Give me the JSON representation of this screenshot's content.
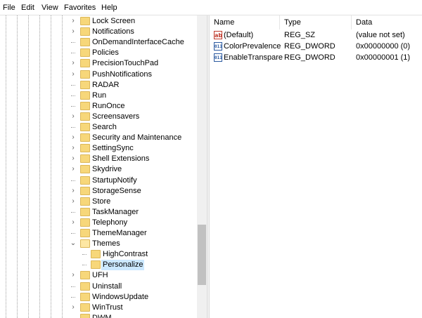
{
  "menu": [
    {
      "label": "File"
    },
    {
      "label": "Edit"
    },
    {
      "label": "View"
    },
    {
      "label": "Favorites"
    },
    {
      "label": "Help"
    }
  ],
  "tree": {
    "items": [
      {
        "label": "Lock Screen",
        "expander": "collapsed"
      },
      {
        "label": "Notifications",
        "expander": "collapsed"
      },
      {
        "label": "OnDemandInterfaceCache",
        "expander": "none"
      },
      {
        "label": "Policies",
        "expander": "none"
      },
      {
        "label": "PrecisionTouchPad",
        "expander": "collapsed"
      },
      {
        "label": "PushNotifications",
        "expander": "collapsed"
      },
      {
        "label": "RADAR",
        "expander": "none"
      },
      {
        "label": "Run",
        "expander": "none"
      },
      {
        "label": "RunOnce",
        "expander": "none"
      },
      {
        "label": "Screensavers",
        "expander": "collapsed"
      },
      {
        "label": "Search",
        "expander": "none"
      },
      {
        "label": "Security and Maintenance",
        "expander": "collapsed"
      },
      {
        "label": "SettingSync",
        "expander": "collapsed"
      },
      {
        "label": "Shell Extensions",
        "expander": "collapsed"
      },
      {
        "label": "Skydrive",
        "expander": "collapsed"
      },
      {
        "label": "StartupNotify",
        "expander": "none"
      },
      {
        "label": "StorageSense",
        "expander": "collapsed"
      },
      {
        "label": "Store",
        "expander": "collapsed"
      },
      {
        "label": "TaskManager",
        "expander": "none"
      },
      {
        "label": "Telephony",
        "expander": "collapsed"
      },
      {
        "label": "ThemeManager",
        "expander": "none"
      },
      {
        "label": "Themes",
        "expander": "expanded"
      },
      {
        "label": "HighContrast",
        "expander": "none"
      },
      {
        "label": "Personalize",
        "expander": "none",
        "selected": true
      },
      {
        "label": "UFH",
        "expander": "collapsed"
      },
      {
        "label": "Uninstall",
        "expander": "none"
      },
      {
        "label": "WindowsUpdate",
        "expander": "none"
      },
      {
        "label": "WinTrust",
        "expander": "collapsed"
      },
      {
        "label": "DWM",
        "expander": "none"
      }
    ]
  },
  "values": {
    "headers": {
      "name": "Name",
      "type": "Type",
      "data": "Data"
    },
    "rows": [
      {
        "name": "(Default)",
        "type": "REG_SZ",
        "data": "(value not set)",
        "icon": "string-value-icon",
        "icon_text": "ab"
      },
      {
        "name": "ColorPrevalence",
        "type": "REG_DWORD",
        "data": "0x00000000 (0)",
        "icon": "binary-value-icon",
        "icon_text": "011"
      },
      {
        "name": "EnableTranspare...",
        "type": "REG_DWORD",
        "data": "0x00000001 (1)",
        "icon": "binary-value-icon",
        "icon_text": "011"
      }
    ]
  },
  "colors": {
    "selection": "#cce8ff",
    "folder": "#f7d77a",
    "string_icon": "#c0392b",
    "dword_icon": "#2c5aa0"
  }
}
